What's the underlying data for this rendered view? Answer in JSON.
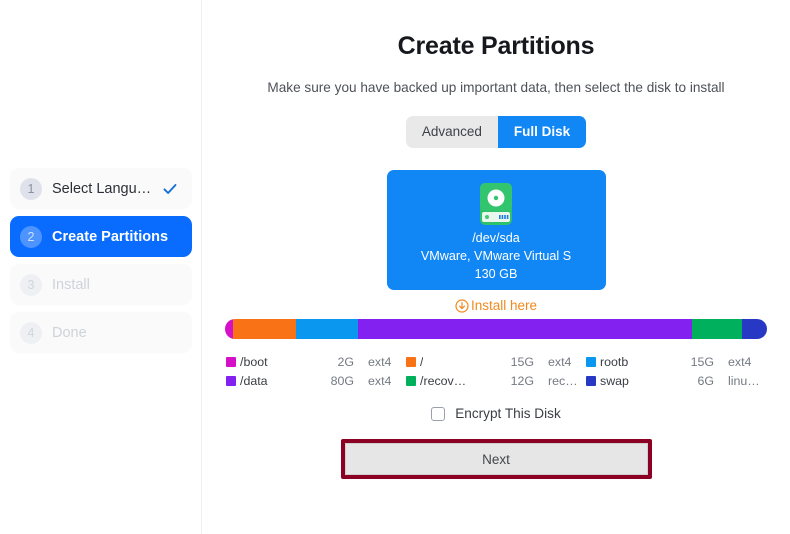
{
  "sidebar": {
    "steps": [
      {
        "num": "1",
        "label": "Select Langu…",
        "state": "done",
        "check_icon": "check-icon"
      },
      {
        "num": "2",
        "label": "Create Partitions",
        "state": "active",
        "check_icon": ""
      },
      {
        "num": "3",
        "label": "Install",
        "state": "disabled",
        "check_icon": ""
      },
      {
        "num": "4",
        "label": "Done",
        "state": "disabled",
        "check_icon": ""
      }
    ]
  },
  "main": {
    "title": "Create Partitions",
    "subtitle": "Make sure you have backed up important data, then select the disk to install",
    "mode_toggle": {
      "options": [
        "Advanced",
        "Full Disk"
      ],
      "selected": "Full Disk"
    },
    "disk": {
      "icon": "hard-disk-icon",
      "device": "/dev/sda",
      "model": "VMware, VMware Virtual S",
      "capacity": "130 GB",
      "selected": true
    },
    "install_here": {
      "icon": "arrow-down-circle-icon",
      "label": "Install here",
      "color": "#f08a1e"
    },
    "encrypt": {
      "label": "Encrypt This Disk",
      "checked": false
    },
    "next_button": {
      "label": "Next",
      "highlight_color": "#8b0023"
    }
  },
  "partitions": {
    "bar": [
      {
        "name": "/boot",
        "color": "#d411c9",
        "weight": 2
      },
      {
        "name": "/",
        "color": "#f97316",
        "weight": 15
      },
      {
        "name": "rootb",
        "color": "#0a97f0",
        "weight": 15
      },
      {
        "name": "/data",
        "color": "#8321f0",
        "weight": 80
      },
      {
        "name": "/recovery",
        "color": "#00b05c",
        "weight": 12
      },
      {
        "name": "swap",
        "color": "#2739c4",
        "weight": 6
      }
    ],
    "legend": [
      {
        "color": "#d411c9",
        "name": "/boot",
        "size": "2G",
        "fs": "ext4"
      },
      {
        "color": "#f97316",
        "name": "/",
        "size": "15G",
        "fs": "ext4"
      },
      {
        "color": "#0a97f0",
        "name": "rootb",
        "size": "15G",
        "fs": "ext4"
      },
      {
        "color": "#8321f0",
        "name": "/data",
        "size": "80G",
        "fs": "ext4"
      },
      {
        "color": "#00b05c",
        "name": "/recov…",
        "size": "12G",
        "fs": "rec…"
      },
      {
        "color": "#2739c4",
        "name": "swap",
        "size": "6G",
        "fs": "linu…"
      }
    ]
  }
}
